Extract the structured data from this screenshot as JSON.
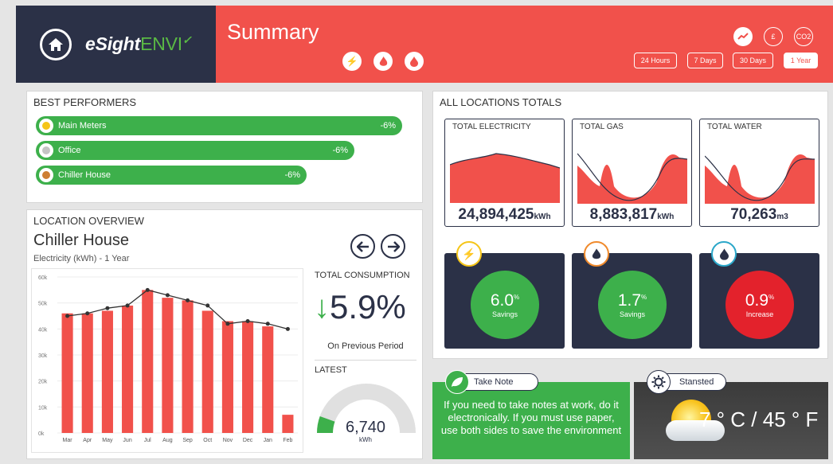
{
  "brand": {
    "name_bold": "eSight",
    "name_light": "ENVI"
  },
  "header": {
    "title": "Summary",
    "utility_icons": [
      "electricity-icon",
      "gas-icon",
      "water-icon"
    ],
    "view_icons": [
      "trend-icon",
      "pound-icon",
      "co2-icon"
    ],
    "co2_label": "CO2",
    "pound_label": "£",
    "periods": [
      "24 Hours",
      "7 Days",
      "30 Days",
      "1 Year"
    ],
    "active_period": "1 Year"
  },
  "best_performers": {
    "title": "BEST PERFORMERS",
    "items": [
      {
        "name": "Main Meters",
        "change": "-6%",
        "medal": "gold",
        "level": 1.0
      },
      {
        "name": "Office",
        "change": "-6%",
        "medal": "silver",
        "level": 0.87
      },
      {
        "name": "Chiller House",
        "change": "-6%",
        "medal": "bronze",
        "level": 0.74
      }
    ]
  },
  "location_overview": {
    "title": "LOCATION OVERVIEW",
    "location": "Chiller House",
    "subtitle": "Electricity (kWh) - 1 Year",
    "total_label": "TOTAL CONSUMPTION",
    "total_change": "5.9%",
    "total_note": "On Previous Period",
    "latest_label": "LATEST",
    "latest_value": "6,740",
    "latest_unit": "kWh",
    "latest_fraction": 0.11
  },
  "chart_data": {
    "type": "bar",
    "categories": [
      "Mar",
      "Apr",
      "May",
      "Jun",
      "Jul",
      "Aug",
      "Sep",
      "Oct",
      "Nov",
      "Dec",
      "Jan",
      "Feb"
    ],
    "series": [
      {
        "values": [
          46000,
          46000,
          47000,
          49000,
          55000,
          52000,
          51000,
          47000,
          43000,
          43000,
          41000,
          7000
        ]
      },
      {
        "values": [
          45000,
          46000,
          48000,
          49000,
          55000,
          53000,
          51000,
          49000,
          42000,
          43000,
          42000,
          40000
        ]
      }
    ],
    "yticks": [
      "0k",
      "10k",
      "20k",
      "30k",
      "40k",
      "50k",
      "60k"
    ],
    "ylim": [
      0,
      60000
    ],
    "grid": true,
    "colors": {
      "bars": "#f1514b",
      "line": "#333333"
    }
  },
  "all_locations": {
    "title": "ALL LOCATIONS TOTALS",
    "cards": [
      {
        "title": "TOTAL ELECTRICITY",
        "value": "24,894,425",
        "unit": "kWh"
      },
      {
        "title": "TOTAL GAS",
        "value": "8,883,817",
        "unit": "kWh"
      },
      {
        "title": "TOTAL WATER",
        "value": "70,263",
        "unit": "m3"
      }
    ],
    "savings": [
      {
        "icon": "electricity-icon",
        "value": "6.0",
        "sup": "%",
        "label": "Savings",
        "color": "#3db04b",
        "ring": "#f5c518"
      },
      {
        "icon": "gas-icon",
        "value": "1.7",
        "sup": "%",
        "label": "Savings",
        "color": "#3db04b",
        "ring": "#f08a2c"
      },
      {
        "icon": "water-icon",
        "value": "0.9",
        "sup": "%",
        "label": "Increase",
        "color": "#e3222c",
        "ring": "#2ba7c9"
      }
    ]
  },
  "take_note": {
    "label": "Take Note",
    "text": "If you need to take notes at work, do it electronically. If you must use paper, use both sides to save the environment"
  },
  "weather": {
    "location": "Stansted",
    "temp": "7 ° C / 45 ° F"
  },
  "colors": {
    "navy": "#2b3147",
    "red": "#f1514b",
    "green": "#3db04b"
  }
}
